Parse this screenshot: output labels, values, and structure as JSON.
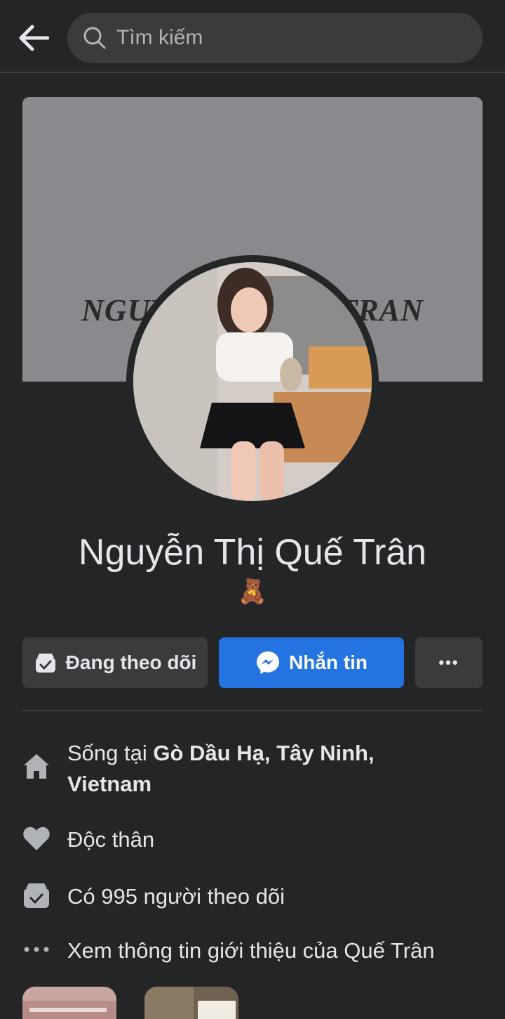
{
  "search": {
    "placeholder": "Tìm kiếm"
  },
  "cover": {
    "text": "NGUYENTHIQUETRAN"
  },
  "profile": {
    "name": "Nguyễn Thị Quế Trân",
    "bio_emoji": "🧸"
  },
  "actions": {
    "follow_label": "Đang theo dõi",
    "message_label": "Nhắn tin",
    "more_label": "•••"
  },
  "info": {
    "lives_prefix": "Sống tại ",
    "lives_place": "Gò Dầu Hạ, Tây Ninh, Vietnam",
    "relationship": "Độc thân",
    "followers": "Có 995 người theo dõi",
    "see_about": "Xem thông tin giới thiệu của Quế Trân"
  },
  "colors": {
    "background": "#242526",
    "surface": "#3a3b3c",
    "accent": "#2374e1",
    "text": "#e4e6eb",
    "muted": "#b0b3b8"
  },
  "icons": [
    "back-arrow-icon",
    "search-icon",
    "follow-check-icon",
    "messenger-icon",
    "more-dots-icon",
    "home-icon",
    "heart-icon",
    "followers-icon",
    "more-dots-icon"
  ]
}
